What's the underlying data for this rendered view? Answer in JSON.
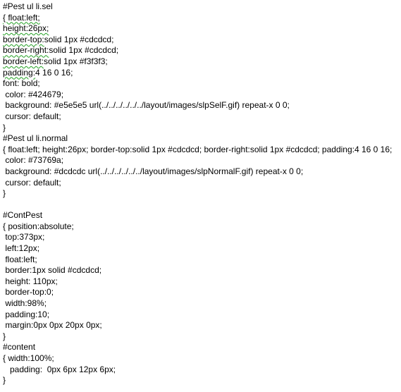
{
  "blocks": [
    {
      "lines": [
        {
          "kind": "plain",
          "text": "#Pest ul li.sel"
        },
        {
          "kind": "sq",
          "text": "{ float:left;"
        },
        {
          "kind": "sq",
          "text": "height:26px;"
        },
        {
          "kind": "split",
          "a": "border-top:",
          "b": "solid 1px #cdcdcd;"
        },
        {
          "kind": "split",
          "a": "border-right:",
          "b": "solid 1px #cdcdcd;"
        },
        {
          "kind": "split",
          "a": "border-left:",
          "b": "solid 1px #f3f3f3;"
        },
        {
          "kind": "split",
          "a": "padding:",
          "b": "4 16 0 16;"
        },
        {
          "kind": "plain",
          "text": "font: bold;"
        },
        {
          "kind": "plain",
          "text": " color: #424679;"
        },
        {
          "kind": "plain",
          "text": " background: #e5e5e5 url(../../../../../../layout/images/slpSelF.gif) repeat-x 0 0;"
        },
        {
          "kind": "plain",
          "text": " cursor: default;"
        },
        {
          "kind": "plain",
          "text": "}"
        }
      ]
    },
    {
      "lines": [
        {
          "kind": "plain",
          "text": "#Pest ul li.normal"
        },
        {
          "kind": "wrap",
          "text": "{ float:left; height:26px; border-top:solid 1px #cdcdcd; border-right:solid 1px #cdcdcd; padding:4 16 0 16;"
        },
        {
          "kind": "plain",
          "text": " color: #73769a;"
        },
        {
          "kind": "plain",
          "text": " background: #dcdcdc url(../../../../../../layout/images/slpNormalF.gif) repeat-x 0 0;"
        },
        {
          "kind": "plain",
          "text": " cursor: default;"
        },
        {
          "kind": "plain",
          "text": "}"
        }
      ]
    },
    {
      "lines": [
        {
          "kind": "blank"
        },
        {
          "kind": "plain",
          "text": "#ContPest"
        },
        {
          "kind": "plain",
          "text": "{ position:absolute;"
        },
        {
          "kind": "plain",
          "text": " top:373px;"
        },
        {
          "kind": "plain",
          "text": " left:12px;"
        },
        {
          "kind": "plain",
          "text": " float:left;"
        },
        {
          "kind": "plain",
          "text": " border:1px solid #cdcdcd;"
        },
        {
          "kind": "plain",
          "text": " height: 110px;"
        },
        {
          "kind": "plain",
          "text": " border-top:0;"
        },
        {
          "kind": "plain",
          "text": " width:98%;"
        },
        {
          "kind": "plain",
          "text": " padding:10;"
        },
        {
          "kind": "plain",
          "text": " margin:0px 0px 20px 0px;"
        },
        {
          "kind": "plain",
          "text": "}"
        }
      ]
    },
    {
      "lines": [
        {
          "kind": "plain",
          "text": "#content"
        },
        {
          "kind": "plain",
          "text": "{ width:100%;"
        },
        {
          "kind": "plain",
          "text": "   padding:  0px 6px 12px 6px;"
        },
        {
          "kind": "plain",
          "text": "}"
        }
      ]
    }
  ]
}
